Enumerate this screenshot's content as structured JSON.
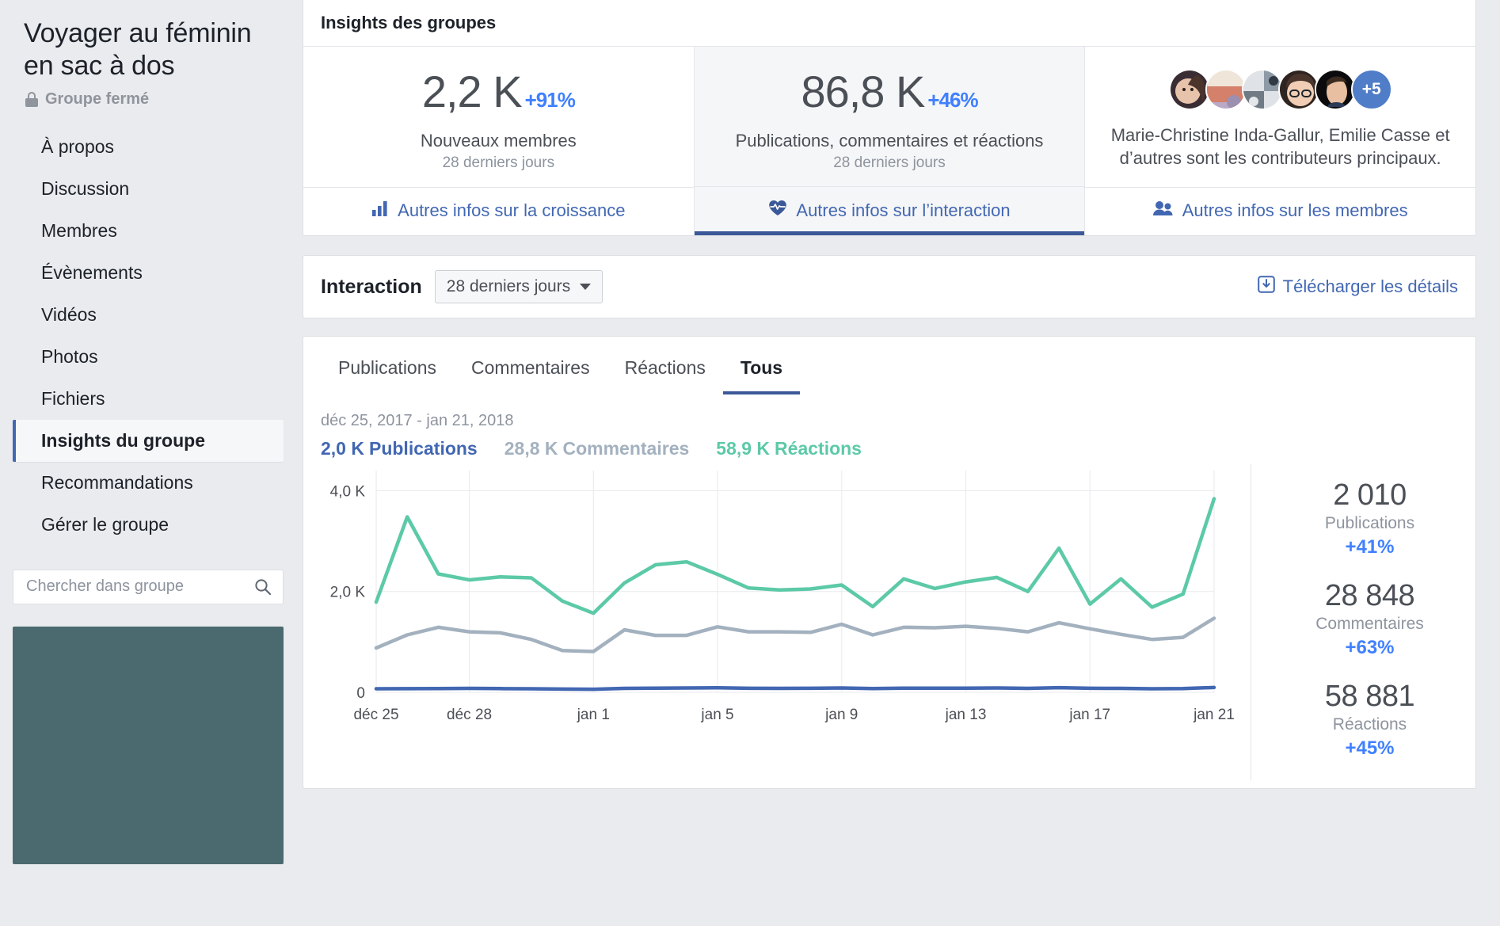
{
  "sidebar": {
    "group_title": "Voyager au féminin en sac à dos",
    "privacy_label": "Groupe fermé",
    "nav_items": [
      {
        "label": "À propos",
        "active": false
      },
      {
        "label": "Discussion",
        "active": false
      },
      {
        "label": "Membres",
        "active": false
      },
      {
        "label": "Évènements",
        "active": false
      },
      {
        "label": "Vidéos",
        "active": false
      },
      {
        "label": "Photos",
        "active": false
      },
      {
        "label": "Fichiers",
        "active": false
      },
      {
        "label": "Insights du groupe",
        "active": true
      },
      {
        "label": "Recommandations",
        "active": false
      },
      {
        "label": "Gérer le groupe",
        "active": false
      }
    ],
    "search_placeholder": "Chercher dans groupe",
    "search_value": ""
  },
  "insights": {
    "title": "Insights des groupes",
    "cards": [
      {
        "number": "2,2 K",
        "delta": "+91%",
        "label": "Nouveaux membres",
        "sublabel": "28 derniers jours",
        "link_label": "Autres infos sur la croissance",
        "link_icon": "bar-chart-icon",
        "selected": false
      },
      {
        "number": "86,8 K",
        "delta": "+46%",
        "label": "Publications, commentaires et réactions",
        "sublabel": "28 derniers jours",
        "link_label": "Autres infos sur l’interaction",
        "link_icon": "heart-pulse-icon",
        "selected": true
      },
      {
        "contributors_text": "Marie-Christine Inda-Gallur, Emilie Casse et d’autres sont les contributeurs principaux.",
        "avatar_more": "+5",
        "avatar_count": 5,
        "link_label": "Autres infos sur les membres",
        "link_icon": "people-icon",
        "selected": false
      }
    ]
  },
  "toolbar": {
    "title": "Interaction",
    "range_value": "28 derniers jours",
    "download_label": "Télécharger les détails"
  },
  "chart_panel": {
    "tabs": [
      {
        "label": "Publications",
        "active": false
      },
      {
        "label": "Commentaires",
        "active": false
      },
      {
        "label": "Réactions",
        "active": false
      },
      {
        "label": "Tous",
        "active": true
      }
    ],
    "range_text": "déc 25, 2017 - jan 21, 2018",
    "legend": [
      {
        "value": "2,0 K",
        "name": "Publications",
        "color": "#4267b2"
      },
      {
        "value": "28,8 K",
        "name": "Commentaires",
        "color": "#a3b1bf"
      },
      {
        "value": "58,9 K",
        "name": "Réactions",
        "color": "#5cc9a7"
      }
    ],
    "summaries": [
      {
        "number": "2 010",
        "label": "Publications",
        "delta": "+41%"
      },
      {
        "number": "28 848",
        "label": "Commentaires",
        "delta": "+63%"
      },
      {
        "number": "58 881",
        "label": "Réactions",
        "delta": "+45%"
      }
    ]
  },
  "chart_data": {
    "type": "line",
    "title": "Interaction — Tous",
    "subtitle": "déc 25, 2017 - jan 21, 2018",
    "xlabel": "",
    "ylabel": "",
    "ylim": [
      0,
      4400
    ],
    "yticks": [
      0,
      2000,
      4000
    ],
    "ytick_labels": [
      "0",
      "2,0 K",
      "4,0 K"
    ],
    "grid": true,
    "legend_position": "top",
    "x": [
      "déc 25",
      "déc 26",
      "déc 27",
      "déc 28",
      "déc 29",
      "déc 30",
      "déc 31",
      "jan 1",
      "jan 2",
      "jan 3",
      "jan 4",
      "jan 5",
      "jan 6",
      "jan 7",
      "jan 8",
      "jan 9",
      "jan 10",
      "jan 11",
      "jan 12",
      "jan 13",
      "jan 14",
      "jan 15",
      "jan 16",
      "jan 17",
      "jan 18",
      "jan 19",
      "jan 20",
      "jan 21"
    ],
    "xtick_labels": [
      "déc 25",
      "déc 28",
      "jan 1",
      "jan 5",
      "jan 9",
      "jan 13",
      "jan 17",
      "jan 21"
    ],
    "xtick_indices": [
      0,
      3,
      7,
      11,
      15,
      19,
      23,
      27
    ],
    "series": [
      {
        "name": "Réactions",
        "color": "#5cc9a7",
        "values": [
          1790,
          3480,
          2350,
          2230,
          2290,
          2270,
          1810,
          1570,
          2170,
          2530,
          2590,
          2340,
          2070,
          2030,
          2050,
          2130,
          1700,
          2250,
          2060,
          2190,
          2280,
          2000,
          2860,
          1750,
          2250,
          1690,
          1950,
          3840
        ]
      },
      {
        "name": "Commentaires",
        "color": "#a3b1bf",
        "values": [
          880,
          1140,
          1290,
          1200,
          1180,
          1050,
          830,
          810,
          1240,
          1130,
          1130,
          1300,
          1200,
          1200,
          1190,
          1350,
          1140,
          1290,
          1280,
          1310,
          1270,
          1200,
          1380,
          1260,
          1150,
          1050,
          1090,
          1470
        ]
      },
      {
        "name": "Publications",
        "color": "#4267b2",
        "values": [
          70,
          72,
          75,
          78,
          74,
          70,
          64,
          62,
          78,
          82,
          86,
          90,
          80,
          78,
          80,
          86,
          76,
          84,
          82,
          84,
          86,
          78,
          92,
          80,
          78,
          70,
          74,
          96
        ]
      }
    ]
  }
}
